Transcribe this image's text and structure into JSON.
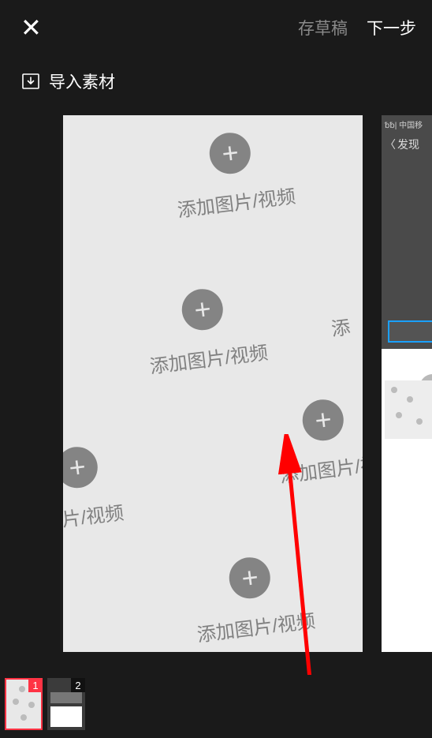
{
  "header": {
    "close_glyph": "✕",
    "draft_label": "存草稿",
    "next_label": "下一步"
  },
  "import": {
    "label": "导入素材"
  },
  "placeholder": {
    "add_label": "添加图片/视频",
    "plus": "+"
  },
  "side": {
    "status": "␢␢| 中国移",
    "back_label": "发现"
  },
  "thumbnails": [
    {
      "index": "1",
      "selected": true
    },
    {
      "index": "2",
      "selected": false
    }
  ]
}
